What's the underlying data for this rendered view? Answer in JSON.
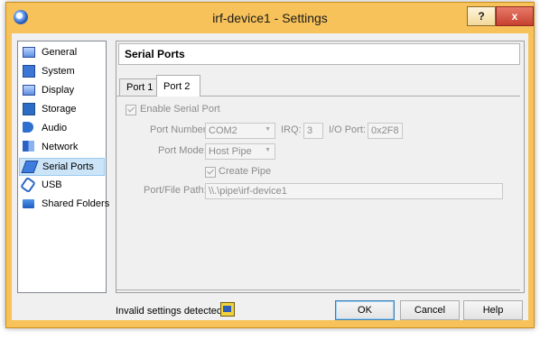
{
  "window": {
    "title": "irf-device1 - Settings",
    "help_label": "?",
    "close_label": "x"
  },
  "sidebar": {
    "items": [
      {
        "label": "General",
        "icon": "monitor-icon"
      },
      {
        "label": "System",
        "icon": "chip-icon"
      },
      {
        "label": "Display",
        "icon": "display-icon"
      },
      {
        "label": "Storage",
        "icon": "storage-icon"
      },
      {
        "label": "Audio",
        "icon": "speaker-icon"
      },
      {
        "label": "Network",
        "icon": "network-icon"
      },
      {
        "label": "Serial Ports",
        "icon": "serial-port-icon",
        "selected": true
      },
      {
        "label": "USB",
        "icon": "usb-icon"
      },
      {
        "label": "Shared Folders",
        "icon": "folder-icon"
      }
    ]
  },
  "main": {
    "section_title": "Serial Ports",
    "tabs": [
      {
        "label": "Port 1"
      },
      {
        "label": "Port 2",
        "active": true
      }
    ],
    "enable_label": "Enable Serial Port",
    "port_number_label": "Port Number:",
    "port_number_value": "COM2",
    "irq_label": "IRQ:",
    "irq_value": "3",
    "io_port_label": "I/O Port:",
    "io_port_value": "0x2F8",
    "port_mode_label": "Port Mode:",
    "port_mode_value": "Host Pipe",
    "create_pipe_label": "Create Pipe",
    "path_label": "Port/File Path:",
    "path_value": "\\\\.\\pipe\\irf-device1"
  },
  "footer": {
    "warning_text": "Invalid settings detected",
    "ok_label": "OK",
    "cancel_label": "Cancel",
    "help_label": "Help"
  }
}
